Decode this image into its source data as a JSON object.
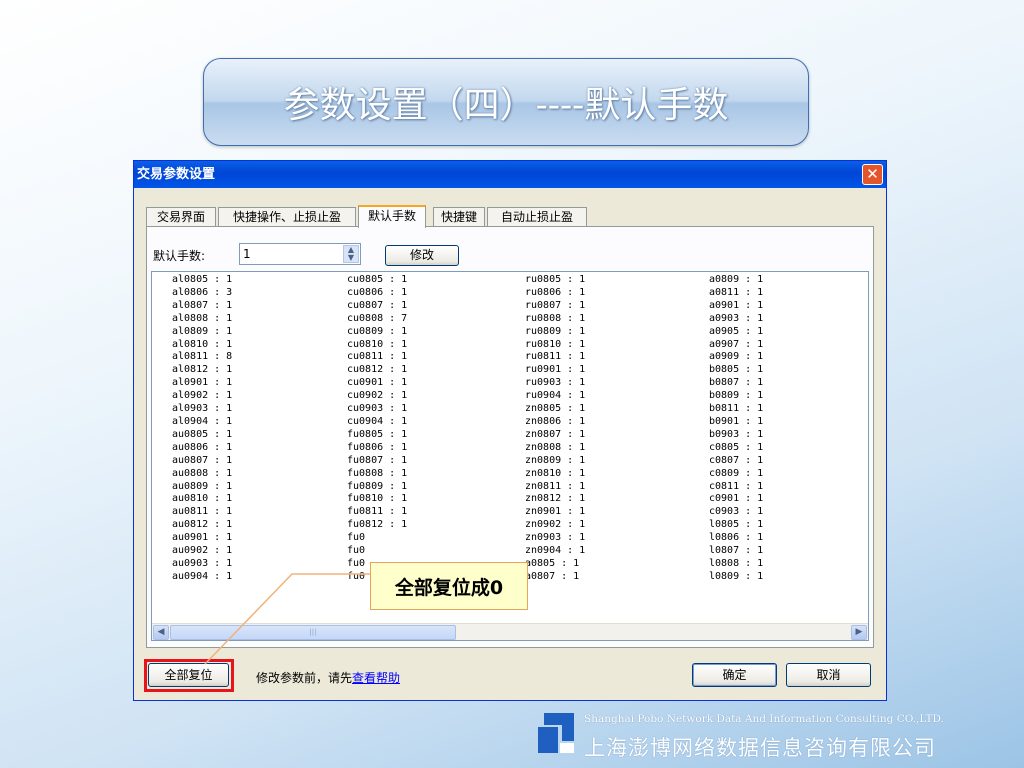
{
  "slide_title": "参数设置（四）----默认手数",
  "dialog": {
    "title": "交易参数设置",
    "close_glyph": "✕"
  },
  "tabs": [
    "交易界面",
    "快捷操作、止损止盈",
    "默认手数",
    "快捷键",
    "自动止损止盈"
  ],
  "active_tab": 2,
  "default_lots": {
    "label": "默认手数:",
    "value": "1",
    "modify_label": "修改"
  },
  "list": {
    "columns": [
      [
        "al0805 : 1",
        "al0806 : 3",
        "al0807 : 1",
        "al0808 : 1",
        "al0809 : 1",
        "al0810 : 1",
        "al0811 : 8",
        "al0812 : 1",
        "al0901 : 1",
        "al0902 : 1",
        "al0903 : 1",
        "al0904 : 1",
        "au0805 : 1",
        "au0806 : 1",
        "au0807 : 1",
        "au0808 : 1",
        "au0809 : 1",
        "au0810 : 1",
        "au0811 : 1",
        "au0812 : 1",
        "au0901 : 1",
        "au0902 : 1",
        "au0903 : 1",
        "au0904 : 1"
      ],
      [
        "cu0805 : 1",
        "cu0806 : 1",
        "cu0807 : 1",
        "cu0808 : 7",
        "cu0809 : 1",
        "cu0810 : 1",
        "cu0811 : 1",
        "cu0812 : 1",
        "cu0901 : 1",
        "cu0902 : 1",
        "cu0903 : 1",
        "cu0904 : 1",
        "fu0805 : 1",
        "fu0806 : 1",
        "fu0807 : 1",
        "fu0808 : 1",
        "fu0809 : 1",
        "fu0810 : 1",
        "fu0811 : 1",
        "fu0812 : 1",
        "fu0",
        "fu0",
        "fu0",
        "fu0"
      ],
      [
        "ru0805 : 1",
        "ru0806 : 1",
        "ru0807 : 1",
        "ru0808 : 1",
        "ru0809 : 1",
        "ru0810 : 1",
        "ru0811 : 1",
        "ru0901 : 1",
        "ru0903 : 1",
        "ru0904 : 1",
        "zn0805 : 1",
        "zn0806 : 1",
        "zn0807 : 1",
        "zn0808 : 1",
        "zn0809 : 1",
        "zn0810 : 1",
        "zn0811 : 1",
        "zn0812 : 1",
        "zn0901 : 1",
        "zn0902 : 1",
        "zn0903 : 1",
        "zn0904 : 1",
        "a0805 : 1",
        "a0807 : 1"
      ],
      [
        "a0809 : 1",
        "a0811 : 1",
        "a0901 : 1",
        "a0903 : 1",
        "a0905 : 1",
        "a0907 : 1",
        "a0909 : 1",
        "b0805 : 1",
        "b0807 : 1",
        "b0809 : 1",
        "b0811 : 1",
        "b0901 : 1",
        "b0903 : 1",
        "c0805 : 1",
        "c0807 : 1",
        "c0809 : 1",
        "c0811 : 1",
        "c0901 : 1",
        "c0903 : 1",
        "l0805 : 1",
        "l0806 : 1",
        "l0807 : 1",
        "l0808 : 1",
        "l0809 : 1"
      ]
    ]
  },
  "footer": {
    "reset_label": "全部复位",
    "note_prefix": "修改参数前，请先",
    "help_link": "查看帮助",
    "ok_label": "确定",
    "cancel_label": "取消"
  },
  "callout": "全部复位成0",
  "company": {
    "en": "Shanghai Pobo Network Data And Information Consulting CO.,LTD.",
    "cn": "上海澎博网络数据信息咨询有限公司"
  },
  "colors": {
    "highlight": "#e8141b",
    "accent_tab": "#f5a623",
    "titlebar": "#0a5fe6"
  }
}
